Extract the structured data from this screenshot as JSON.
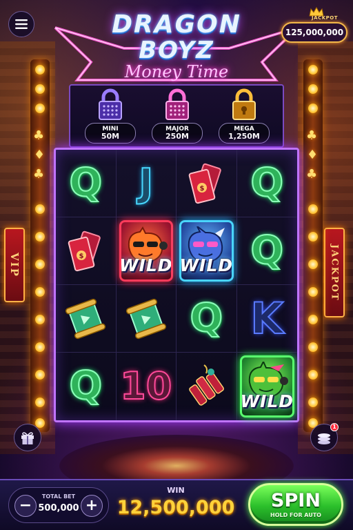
{
  "title": {
    "line1": "DRAGON",
    "line2": "BOYZ",
    "subtitle": "Money Time"
  },
  "jackpot": {
    "label": "JACKPOT",
    "value": "125,000,000"
  },
  "locks": [
    {
      "name": "MINI",
      "amount": "50M",
      "color": "#8b6bff"
    },
    {
      "name": "MAJOR",
      "amount": "250M",
      "color": "#ff4fc8"
    },
    {
      "name": "MEGA",
      "amount": "1,250M",
      "color": "#ffb020"
    }
  ],
  "side_signs": {
    "left": "VIP",
    "right": "JACKPOT"
  },
  "reels": [
    [
      {
        "sym": "Q"
      },
      {
        "sym": "J"
      },
      {
        "sym": "ticket-icon"
      },
      {
        "sym": "Q"
      }
    ],
    [
      {
        "sym": "ticket-icon"
      },
      {
        "sym": "wild",
        "label": "WILD",
        "variant": "red"
      },
      {
        "sym": "wild",
        "label": "WILD",
        "variant": "blue"
      },
      {
        "sym": "Q"
      }
    ],
    [
      {
        "sym": "scroll-icon"
      },
      {
        "sym": "scroll-icon"
      },
      {
        "sym": "Q"
      },
      {
        "sym": "K"
      }
    ],
    [
      {
        "sym": "Q"
      },
      {
        "sym": "10"
      },
      {
        "sym": "firecracker-icon"
      },
      {
        "sym": "wild",
        "label": "WILD",
        "variant": "green"
      }
    ]
  ],
  "bottom": {
    "bet_label": "TOTAL BET",
    "bet_value": "500,000",
    "minus": "−",
    "plus": "+",
    "win_label": "WIN",
    "win_value": "12,500,000",
    "spin_label": "SPIN",
    "spin_sub": "HOLD FOR AUTO",
    "notification_count": "1"
  },
  "colors": {
    "accent_purple": "#c074ff",
    "gold": "#ffd23a",
    "spin_green": "#2bbf2b"
  }
}
